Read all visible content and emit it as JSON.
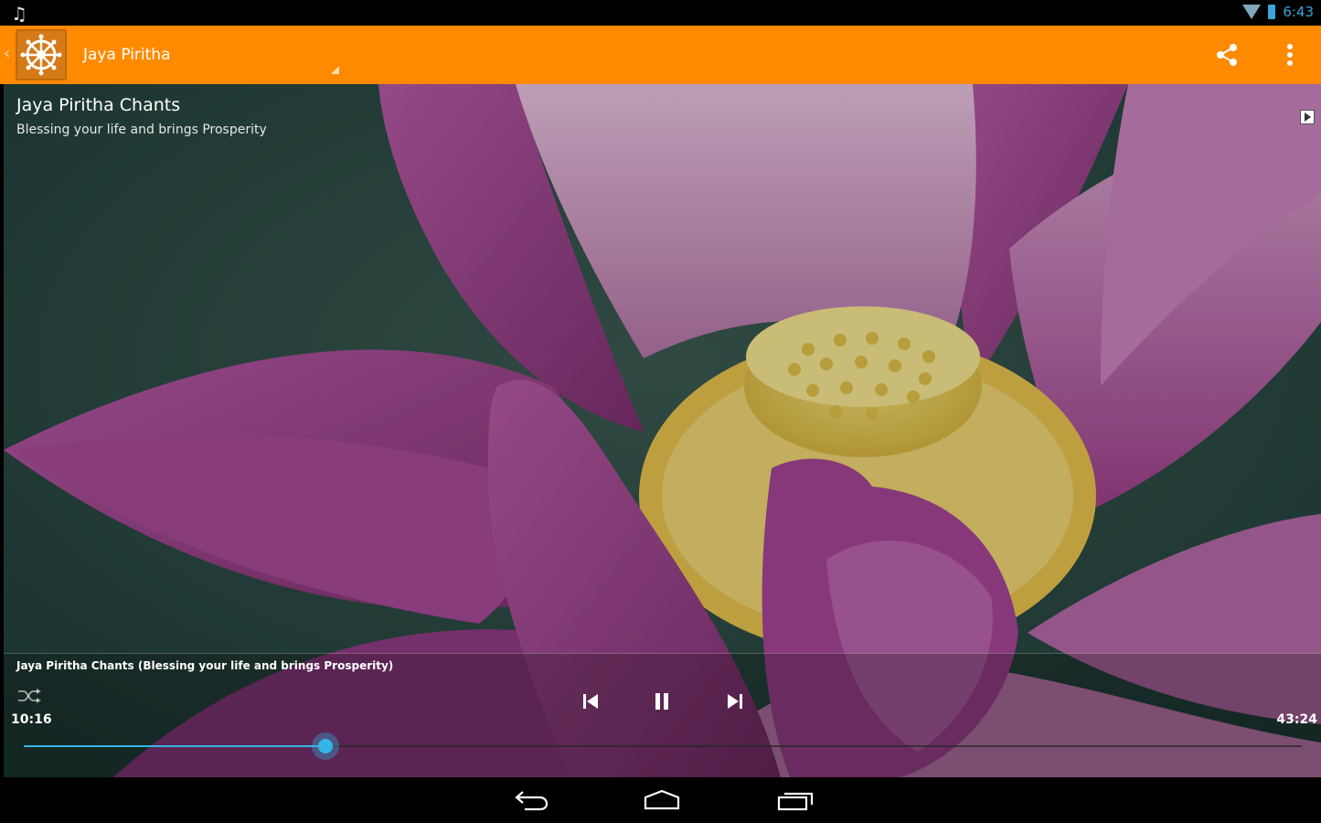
{
  "status_bar": {
    "time": "6:43",
    "icons": [
      "music-note-icon",
      "wifi-icon",
      "battery-icon"
    ]
  },
  "action_bar": {
    "title": "Jaya Piritha",
    "background_color": "#ff8a00",
    "icons": [
      "dharma-wheel-icon",
      "share-icon",
      "overflow-menu-icon"
    ]
  },
  "track": {
    "title": "Jaya Piritha Chants",
    "subtitle": "Blessing your life and brings Prosperity"
  },
  "player": {
    "now_playing": "Jaya Piritha Chants (Blessing your life and brings Prosperity)",
    "elapsed": "10:16",
    "total": "43:24",
    "progress": 0.236,
    "accent_color": "#33b5e5",
    "controls": [
      "shuffle-icon",
      "previous-icon",
      "pause-icon",
      "next-icon"
    ]
  },
  "nav_bar": {
    "icons": [
      "back-icon",
      "home-icon",
      "recents-icon"
    ]
  }
}
